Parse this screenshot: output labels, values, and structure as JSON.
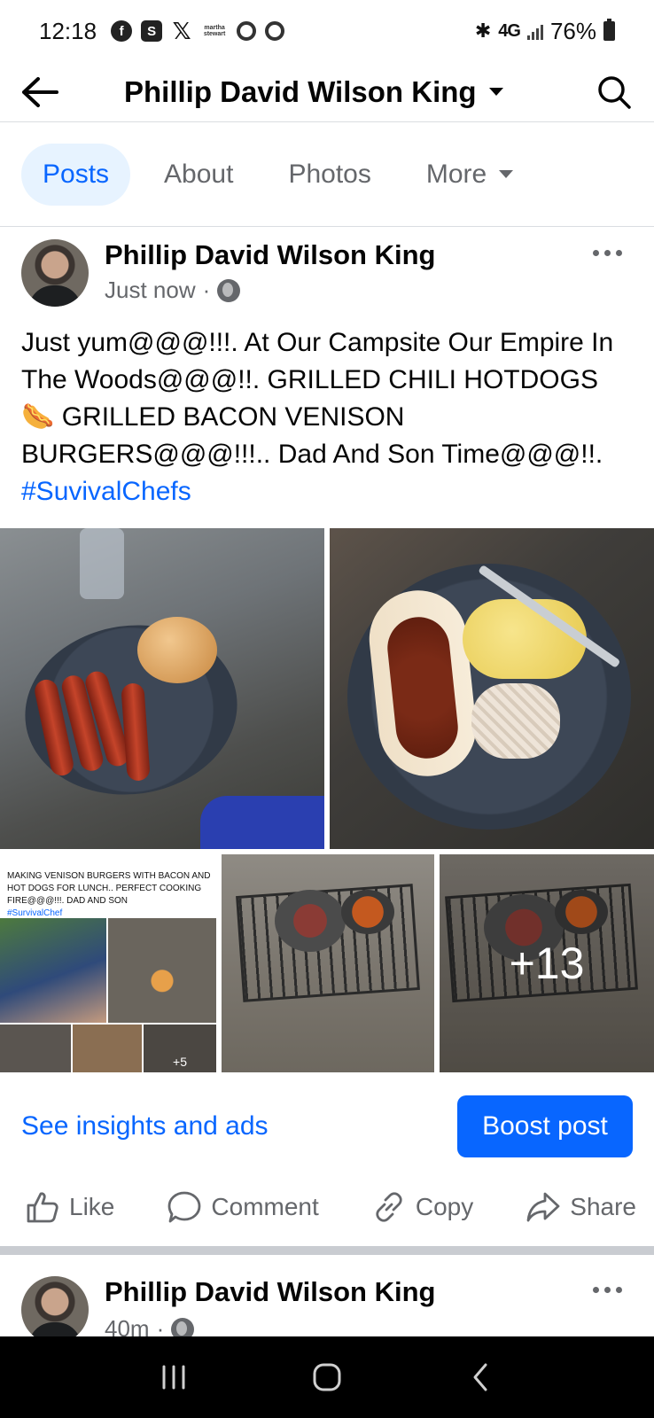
{
  "status_bar": {
    "time": "12:18",
    "app_icons": [
      "facebook-icon",
      "s-app-icon",
      "x-icon",
      "martha-stewart-icon",
      "ring-app-icon",
      "ring-app-icon"
    ],
    "martha_label": "martha stewart",
    "network": "4G",
    "battery": "76%"
  },
  "header": {
    "title": "Phillip David Wilson King"
  },
  "tabs": [
    {
      "label": "Posts",
      "active": true
    },
    {
      "label": "About",
      "active": false
    },
    {
      "label": "Photos",
      "active": false
    },
    {
      "label": "More",
      "active": false
    }
  ],
  "post": {
    "author": "Phillip David Wilson King",
    "time": "Just now",
    "text": "Just yum@@@!!!. At Our Campsite Our Empire In The Woods@@@!!. GRILLED CHILI HOTDOGS 🌭 GRILLED BACON VENISON BURGERS@@@!!!.. Dad And Son Time@@@!!. ",
    "hashtag": "#SuvivalChefs",
    "collage_text": "MAKING VENISON BURGERS WITH BACON AND HOT DOGS FOR LUNCH.. PERFECT COOKING FIRE@@@!!!. DAD AND SON",
    "collage_hashtag": "#SurvivalChef",
    "collage_more": "+5",
    "more_photos": "+13",
    "insights_link": "See insights and ads",
    "boost_label": "Boost post",
    "actions": {
      "like": "Like",
      "comment": "Comment",
      "copy": "Copy",
      "share": "Share"
    }
  },
  "next_post": {
    "author": "Phillip David Wilson King",
    "time": "40m"
  }
}
